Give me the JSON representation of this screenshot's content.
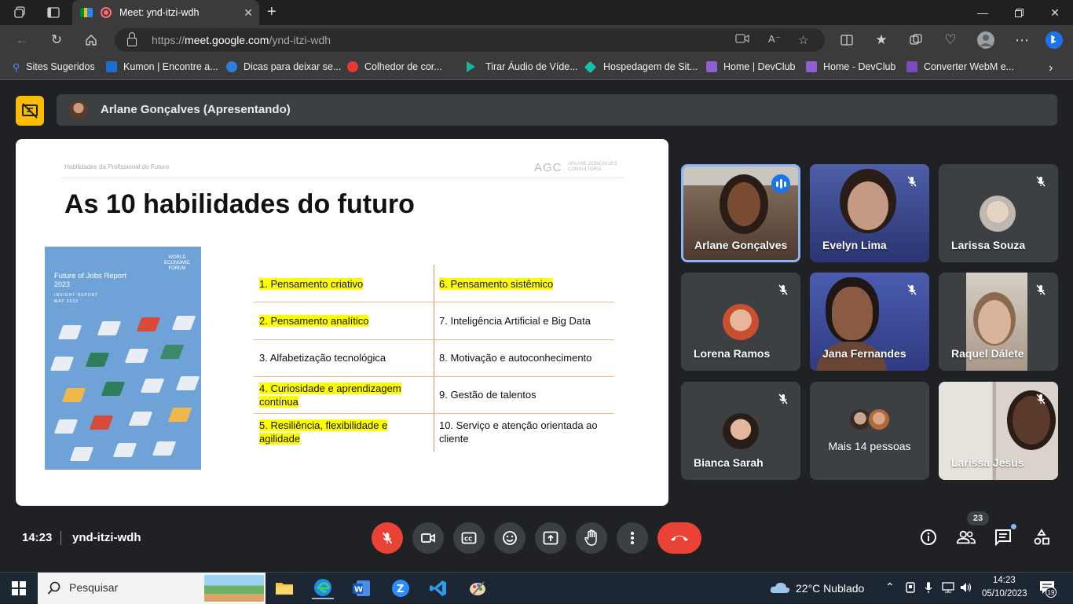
{
  "browser": {
    "tab_title": "Meet: ynd-itzi-wdh",
    "url_prefix": "https://",
    "url_host": "meet.google.com",
    "url_path": "/ynd-itzi-wdh"
  },
  "bookmarks": [
    {
      "label": "Sites Sugeridos",
      "color": "#4f8ef7"
    },
    {
      "label": "Kumon | Encontre a...",
      "color": "#1b6fd1"
    },
    {
      "label": "Dicas para deixar se...",
      "color": "#2b7fe0"
    },
    {
      "label": "Colhedor de cor...",
      "color": "#e53935"
    },
    {
      "label": "Tirar Áudio de Víde...",
      "color": "#16b3a0"
    },
    {
      "label": "Hospedagem de Sit...",
      "color": "#13c1a8"
    },
    {
      "label": "Home | DevClub",
      "color": "#8e5fd4"
    },
    {
      "label": "Home - DevClub",
      "color": "#8e5fd4"
    },
    {
      "label": "Converter WebM e...",
      "color": "#7a4bc0"
    }
  ],
  "presenter": {
    "label": "Arlane Gonçalves (Apresentando)"
  },
  "slide": {
    "header_small": "Habilidades da Profissional do Futuro",
    "logo": "AGC",
    "logo_sub_1": "ARLANE GONÇALVES",
    "logo_sub_2": "CONSULTORIA",
    "title": "As 10 habilidades do futuro",
    "cover": {
      "wef_1": "WORLD",
      "wef_2": "ECONOMIC",
      "wef_3": "FORUM",
      "title": "Future of Jobs Report",
      "year": "2023",
      "sub_1": "INSIGHT REPORT",
      "sub_2": "MAY 2023"
    },
    "skills_left": [
      {
        "text": "1. Pensamento criativo",
        "highlight": true
      },
      {
        "text": "2. Pensamento analítico",
        "highlight": true
      },
      {
        "text": "3. Alfabetização tecnológica",
        "highlight": false
      },
      {
        "text": "4. Curiosidade e aprendizagem contínua",
        "highlight": true
      },
      {
        "text": "5. Resiliência, flexibilidade e agilidade",
        "highlight": true
      }
    ],
    "skills_right": [
      {
        "text": "6. Pensamento sistêmico",
        "highlight": true
      },
      {
        "text": "7. Inteligência Artificial e Big Data",
        "highlight": false
      },
      {
        "text": "8. Motivação e autoconhecimento",
        "highlight": false
      },
      {
        "text": "9. Gestão de talentos",
        "highlight": false
      },
      {
        "text": "10. Serviço e atenção orientada ao cliente",
        "highlight": false
      }
    ]
  },
  "participants": [
    {
      "name": "Arlane Gonçalves",
      "speaking": true
    },
    {
      "name": "Evelyn Lima",
      "muted": true
    },
    {
      "name": "Larissa Souza",
      "muted": true
    },
    {
      "name": "Lorena Ramos",
      "muted": true
    },
    {
      "name": "Jana Fernandes",
      "muted": true
    },
    {
      "name": "Raquel Dálete",
      "muted": true
    },
    {
      "name": "Bianca Sarah",
      "muted": true
    },
    {
      "name": "Mais 14 pessoas"
    },
    {
      "name": "Larissa Jesus",
      "muted": true
    }
  ],
  "bottom": {
    "time": "14:23",
    "meeting_code": "ynd-itzi-wdh",
    "participant_count": "23"
  },
  "taskbar": {
    "search_placeholder": "Pesquisar",
    "weather": "22°C  Nublado",
    "time": "14:23",
    "date": "05/10/2023",
    "notifications": "19"
  },
  "colors": {
    "accent_yellow": "#fbbc04",
    "hangup_red": "#ea4335",
    "meet_bg": "#202124",
    "tile_bg": "#3c4043"
  }
}
